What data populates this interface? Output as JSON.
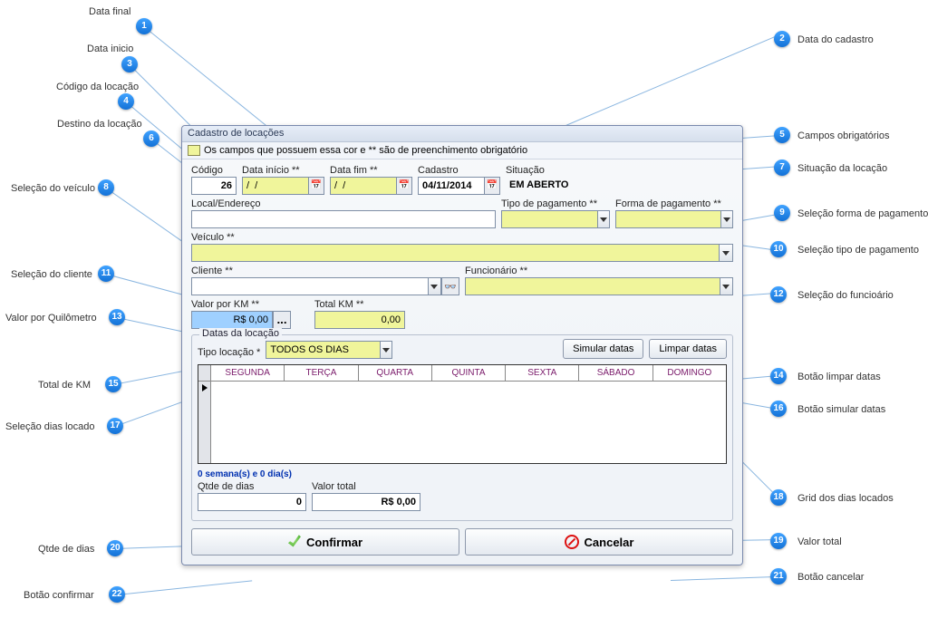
{
  "window_title": "Cadastro de locações",
  "notice": "Os campos que possuem essa cor e ** são de preenchimento obrigatório",
  "fields": {
    "codigo_label": "Código",
    "codigo_value": "26",
    "data_inicio_label": "Data início **",
    "data_inicio_value": "/  /",
    "data_fim_label": "Data fim **",
    "data_fim_value": "/  /",
    "cadastro_label": "Cadastro",
    "cadastro_value": "04/11/2014",
    "situacao_label": "Situação",
    "situacao_value": "EM ABERTO",
    "local_label": "Local/Endereço",
    "local_value": "",
    "tipo_pag_label": "Tipo de pagamento **",
    "forma_pag_label": "Forma de pagamento **",
    "veiculo_label": "Veículo **",
    "cliente_label": "Cliente **",
    "funcionario_label": "Funcionário **",
    "valor_km_label": "Valor por KM **",
    "valor_km_value": "R$ 0,00",
    "total_km_label": "Total KM **",
    "total_km_value": "0,00",
    "datas_legend": "Datas da locação",
    "tipo_loc_label": "Tipo locação *",
    "tipo_loc_value": "TODOS OS DIAS",
    "simular_label": "Simular datas",
    "limpar_label": "Limpar datas",
    "days": [
      "SEGUNDA",
      "TERÇA",
      "QUARTA",
      "QUINTA",
      "SEXTA",
      "SÁBADO",
      "DOMINGO"
    ],
    "summary": "0 semana(s) e 0 dia(s)",
    "qtde_label": "Qtde de dias",
    "qtde_value": "0",
    "valor_total_label": "Valor total",
    "valor_total_value": "R$ 0,00",
    "confirmar": "Confirmar",
    "cancelar": "Cancelar"
  },
  "callouts": {
    "c1": "Data final",
    "c2": "Data do cadastro",
    "c3": "Data inicio",
    "c4": "Código da locação",
    "c5": "Campos obrigatórios",
    "c6": "Destino da locação",
    "c7": "Situação da locação",
    "c8": "Seleção do veículo",
    "c9": "Seleção forma de pagamento",
    "c10": "Seleção tipo de pagamento",
    "c11": "Seleção do cliente",
    "c12": "Seleção do funcioário",
    "c13": "Valor por Quilômetro",
    "c14": "Botão limpar datas",
    "c15": "Total de KM",
    "c16": "Botão simular datas",
    "c17": "Seleção dias locado",
    "c18": "Grid dos dias locados",
    "c19": "Valor total",
    "c20": "Qtde de dias",
    "c21": "Botão cancelar",
    "c22": "Botão confirmar"
  }
}
